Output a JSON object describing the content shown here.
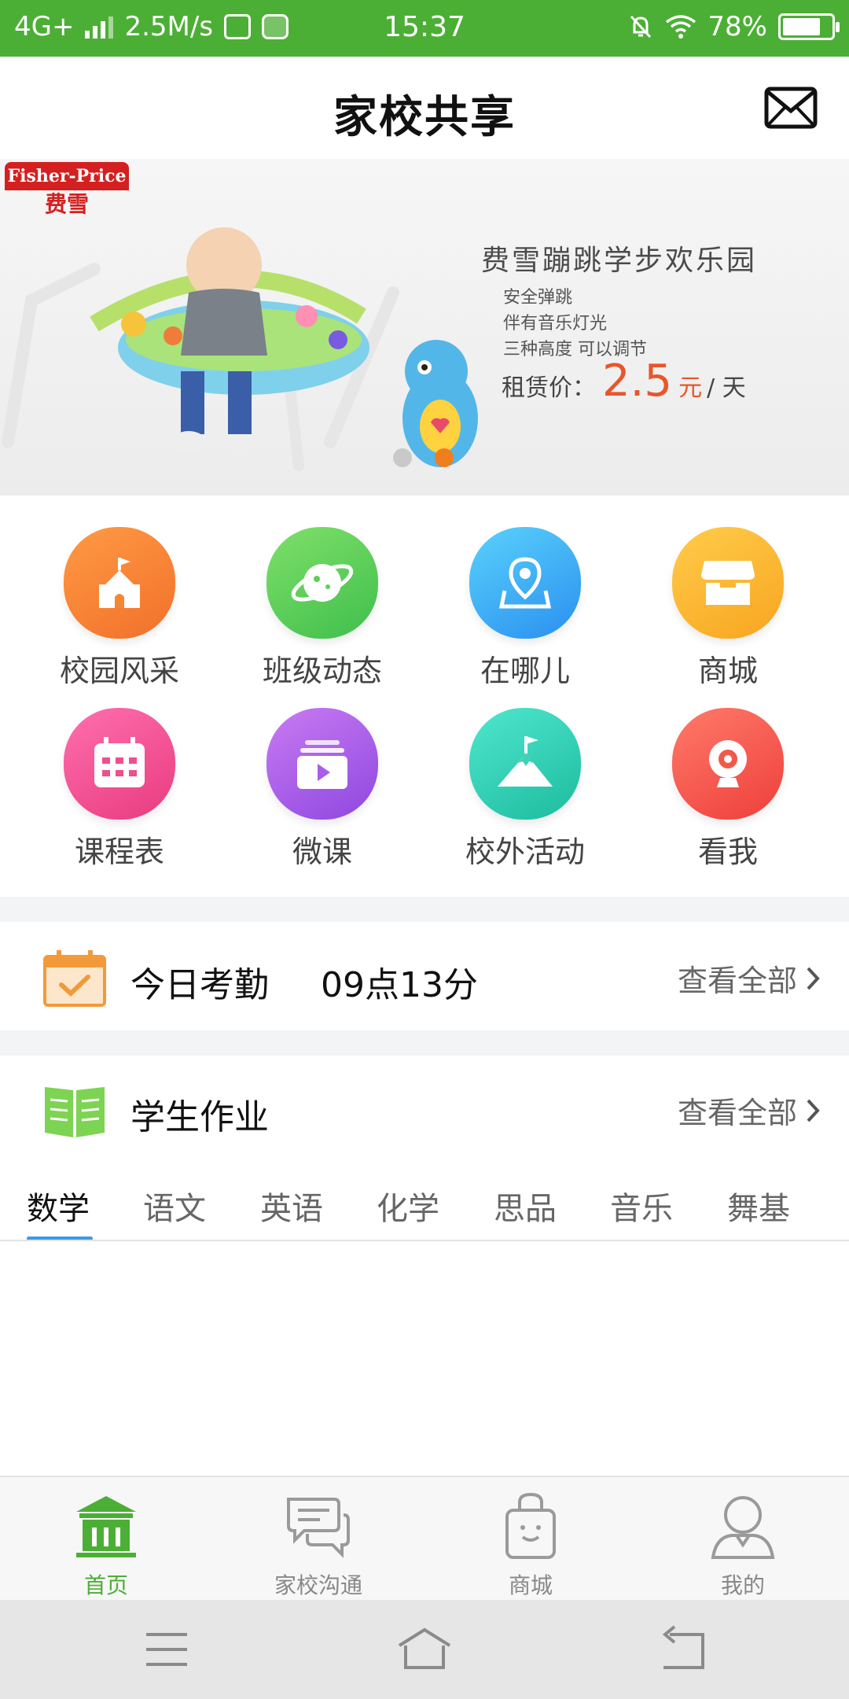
{
  "status_bar": {
    "network": "4G+",
    "speed": "2.5M/s",
    "time": "15:37",
    "battery": "78%",
    "battery_level": 0.78
  },
  "header": {
    "title": "家校共享"
  },
  "banner": {
    "brand_en": "Fisher-Price",
    "brand_cn": "费雪",
    "title": "费雪蹦跳学步欢乐园",
    "features": [
      "安全弹跳",
      "伴有音乐灯光",
      "三种高度 可以调节"
    ],
    "price_label": "租赁价：",
    "price_value": "2.5",
    "price_unit": "元",
    "price_period": "/ 天",
    "slide_count": 2,
    "active_slide": 2
  },
  "grid": [
    {
      "label": "校园风采",
      "icon": "castle-icon",
      "color_from": "#ff9a45",
      "color_to": "#f1702a"
    },
    {
      "label": "班级动态",
      "icon": "planet-icon",
      "color_from": "#7fe06a",
      "color_to": "#3fbf4b"
    },
    {
      "label": "在哪儿",
      "icon": "location-pin-icon",
      "color_from": "#5ad2fb",
      "color_to": "#2a8ff0"
    },
    {
      "label": "商城",
      "icon": "store-icon",
      "color_from": "#ffcc4a",
      "color_to": "#f8a520"
    },
    {
      "label": "课程表",
      "icon": "calendar-icon",
      "color_from": "#ff6fae",
      "color_to": "#e83b7f"
    },
    {
      "label": "微课",
      "icon": "video-play-icon",
      "color_from": "#c97bf2",
      "color_to": "#8e47e0"
    },
    {
      "label": "校外活动",
      "icon": "mountain-flag-icon",
      "color_from": "#4fe7cf",
      "color_to": "#1dbb9e"
    },
    {
      "label": "看我",
      "icon": "webcam-icon",
      "color_from": "#ff7a6a",
      "color_to": "#ee3f3a"
    }
  ],
  "attendance": {
    "title": "今日考勤",
    "time": "09点13分",
    "more": "查看全部"
  },
  "homework": {
    "title": "学生作业",
    "more": "查看全部"
  },
  "subjects": {
    "items": [
      "数学",
      "语文",
      "英语",
      "化学",
      "思品",
      "音乐",
      "舞基"
    ],
    "active": "数学"
  },
  "bottom_nav": [
    {
      "label": "首页",
      "icon": "school-building-icon",
      "active": true
    },
    {
      "label": "家校沟通",
      "icon": "chat-bubbles-icon",
      "active": false
    },
    {
      "label": "商城",
      "icon": "shopping-bag-icon",
      "active": false
    },
    {
      "label": "我的",
      "icon": "user-profile-icon",
      "active": false
    }
  ],
  "colors": {
    "brand_green": "#4caf35",
    "tab_indicator": "#3d9be5",
    "price_orange": "#e8562a"
  }
}
